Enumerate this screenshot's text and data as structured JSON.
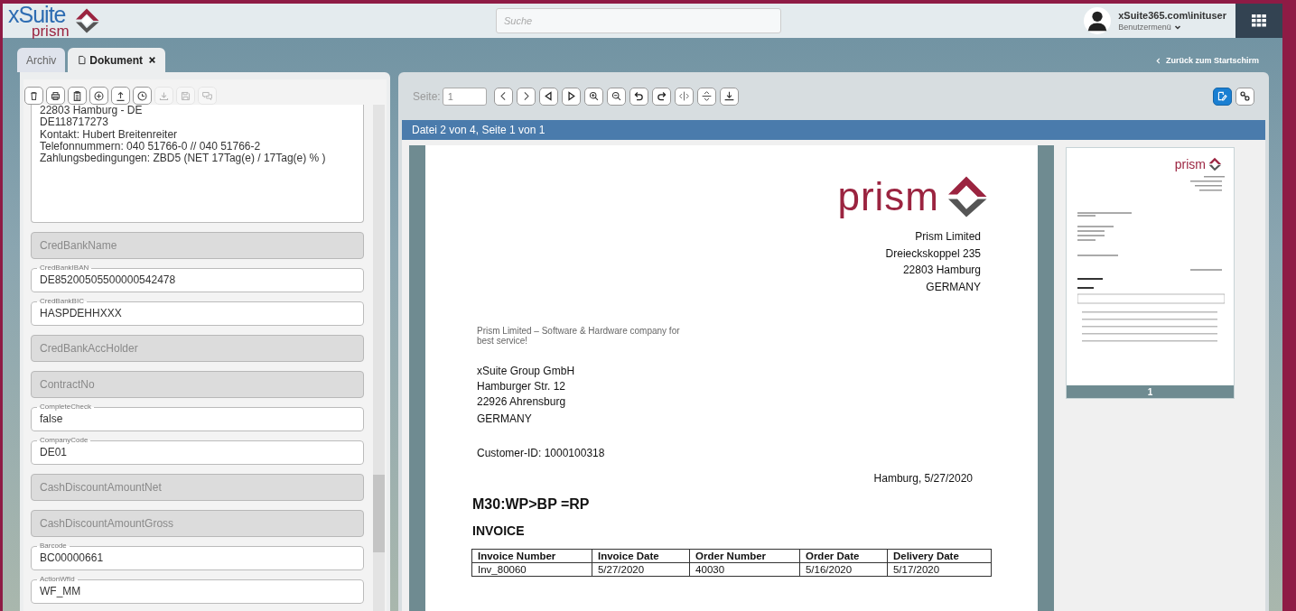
{
  "header": {
    "logo": {
      "line1": "xSuite",
      "line2": "prism"
    },
    "search": {
      "placeholder": "Suche"
    },
    "user": {
      "name": "xSuite365.com\\inituser",
      "menu": "Benutzermenü"
    }
  },
  "tabs": [
    {
      "label": "Archiv",
      "selected": false,
      "closable": false
    },
    {
      "label": "Dokument",
      "selected": true,
      "closable": true
    }
  ],
  "back_link": "Zurück zum Startschirm",
  "left_panel": {
    "toolbar": [
      {
        "disabled": false
      },
      {
        "disabled": false
      },
      {
        "disabled": false
      },
      {
        "disabled": false
      },
      {
        "disabled": false
      },
      {
        "disabled": false
      },
      {
        "disabled": true
      },
      {
        "disabled": true
      },
      {
        "disabled": true
      }
    ],
    "notes": [
      "22803 Hamburg - DE",
      "DE118717273",
      "Kontakt: Hubert Breitenreiter",
      "Telefonnummern: 040 51766-0 // 040 51766-2",
      "Zahlungsbedingungen: ZBD5 (NET 17Tag(e) / 17Tag(e) % )"
    ],
    "fields": [
      {
        "label": "CredBankName",
        "disabled": true
      },
      {
        "label": "CredBankIBAN",
        "value": "DE85200505500000542478",
        "disabled": false
      },
      {
        "label": "CredBankBIC",
        "value": "HASPDEHHXXX",
        "disabled": false
      },
      {
        "label": "CredBankAccHolder",
        "disabled": true
      },
      {
        "label": "ContractNo",
        "disabled": true
      },
      {
        "label": "CompleteCheck",
        "value": "false",
        "disabled": false
      },
      {
        "label": "CompanyCode",
        "value": "DE01",
        "disabled": false
      },
      {
        "label": "CashDiscountAmountNet",
        "disabled": true
      },
      {
        "label": "CashDiscountAmountGross",
        "disabled": true
      },
      {
        "label": "Barcode",
        "value": "BC00000661",
        "disabled": false
      },
      {
        "label": "ActionWfId",
        "value": "WF_MM",
        "disabled": false
      }
    ]
  },
  "viewer": {
    "page_label": "Seite:",
    "page_value": "1",
    "toggles": [
      {
        "selected": true
      },
      {
        "selected": false
      }
    ],
    "info_bar": "Datei 2 von 4, Seite 1 von 1",
    "document": {
      "logo": "prism",
      "sender": [
        "Prism Limited",
        "Dreieckskoppel 235",
        "22803 Hamburg",
        "GERMANY"
      ],
      "tagline": "Prism Limited – Software & Hardware company for best service!",
      "recipient": [
        "xSuite Group GmbH",
        "Hamburger Str. 12",
        "22926 Ahrensburg",
        "GERMANY"
      ],
      "customer_id": "Customer-ID: 1000100318",
      "date": "Hamburg, 5/27/2020",
      "title": "M30:WP>BP =RP",
      "subtitle": "INVOICE",
      "table": {
        "columns": [
          "Invoice Number",
          "Invoice Date",
          "Order Number",
          "Order Date",
          "Delivery Date"
        ],
        "rows": [
          [
            "Inv_80060",
            "5/27/2020",
            "40030",
            "5/16/2020",
            "5/17/2020"
          ]
        ]
      }
    },
    "thumbnail": {
      "logo": "prism",
      "page_number": "1"
    }
  }
}
